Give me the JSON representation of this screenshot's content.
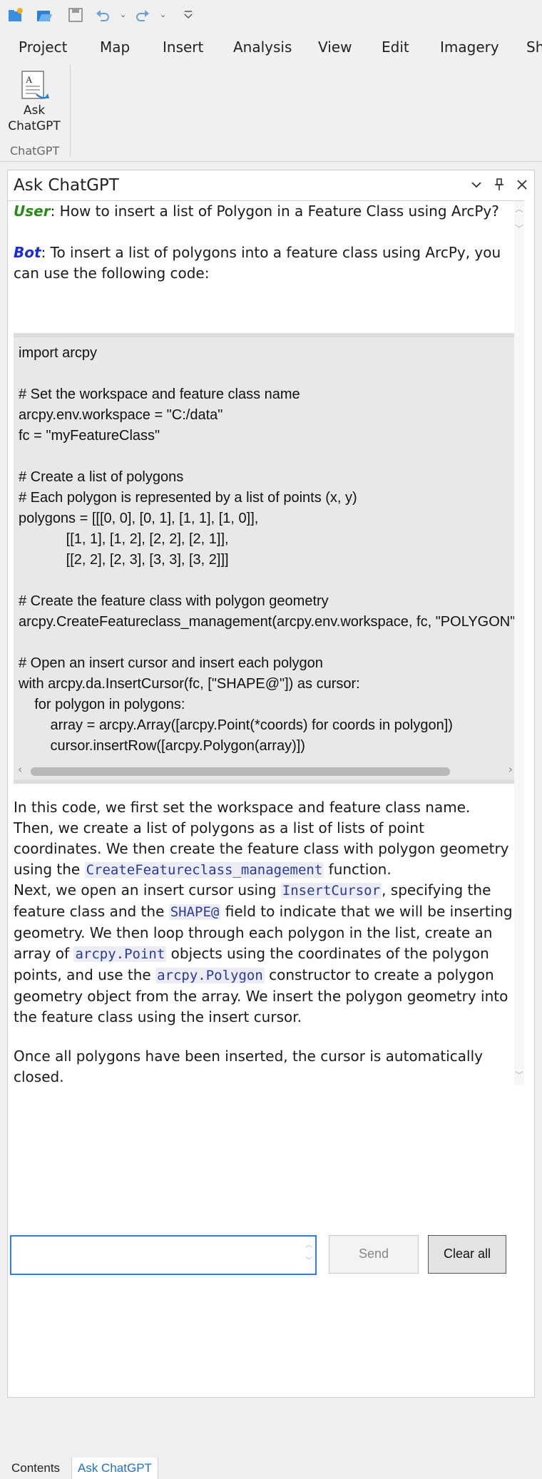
{
  "quick_access": {
    "icons": [
      "new-project-icon",
      "open-project-icon",
      "save-icon",
      "undo-icon",
      "redo-icon",
      "customize-icon"
    ]
  },
  "ribbon": {
    "tabs": [
      "Project",
      "Map",
      "Insert",
      "Analysis",
      "View",
      "Edit",
      "Imagery",
      "Sh"
    ],
    "ask_button_label_line1": "Ask",
    "ask_button_label_line2": "ChatGPT",
    "group_label": "ChatGPT"
  },
  "pane": {
    "title": "Ask ChatGPT",
    "controls": [
      "options-chevron-icon",
      "pin-icon",
      "close-icon"
    ]
  },
  "chat": {
    "user_label": "User",
    "user_text": ": How to insert a list of Polygon in a Feature Class using ArcPy?",
    "bot_label": "Bot",
    "bot_intro": ": To insert a list of polygons into a feature class using ArcPy, you can use the following code:",
    "code": "import arcpy\n\n# Set the workspace and feature class name\narcpy.env.workspace = \"C:/data\"\nfc = \"myFeatureClass\"\n\n# Create a list of polygons\n# Each polygon is represented by a list of points (x, y)\npolygons = [[[0, 0], [0, 1], [1, 1], [1, 0]],\n            [[1, 1], [1, 2], [2, 2], [2, 1]],\n            [[2, 2], [2, 3], [3, 3], [3, 2]]]\n\n# Create the feature class with polygon geometry\narcpy.CreateFeatureclass_management(arcpy.env.workspace, fc, \"POLYGON\")\n\n# Open an insert cursor and insert each polygon\nwith arcpy.da.InsertCursor(fc, [\"SHAPE@\"]) as cursor:\n    for polygon in polygons:\n        array = arcpy.Array([arcpy.Point(*coords) for coords in polygon])\n        cursor.insertRow([arcpy.Polygon(array)])",
    "para1_a": "In this code, we first set the workspace and feature class name. Then, we create a list of polygons as a list of lists of point coordinates. We then create the feature class with polygon geometry using the ",
    "para1_code": "CreateFeatureclass_management",
    "para1_b": " function.",
    "para2_a": "Next, we open an insert cursor using ",
    "para2_code1": "InsertCursor",
    "para2_b": ", specifying the feature class and the ",
    "para2_code2": "SHAPE@",
    "para2_c": " field to indicate that we will be inserting geometry. We then loop through each polygon in the list, create an array of ",
    "para2_code3": "arcpy.Point",
    "para2_d": " objects using the coordinates of the polygon points, and use the ",
    "para2_code4": "arcpy.Polygon",
    "para2_e": " constructor to create a polygon geometry object from the array. We insert the polygon geometry into the feature class using the insert cursor.",
    "para3": "Once all polygons have been inserted, the cursor is automatically closed."
  },
  "input": {
    "value": "",
    "placeholder": ""
  },
  "buttons": {
    "send": "Send",
    "clear_all": "Clear all"
  },
  "bottom_tabs": {
    "contents": "Contents",
    "ask_chatgpt": "Ask ChatGPT"
  }
}
